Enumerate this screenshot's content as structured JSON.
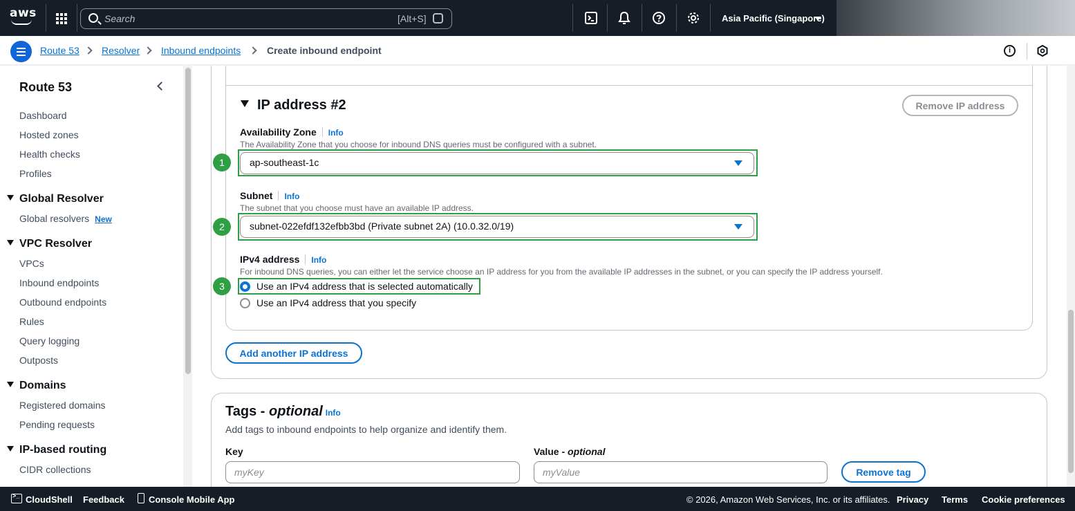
{
  "topnav": {
    "logo_text": "aws",
    "search_placeholder": "Search",
    "search_shortcut": "[Alt+S]",
    "region": "Asia Pacific (Singapore)"
  },
  "breadcrumb": {
    "items": [
      "Route 53",
      "Resolver",
      "Inbound endpoints"
    ],
    "current": "Create inbound endpoint"
  },
  "sidebar": {
    "title": "Route 53",
    "top_items": [
      "Dashboard",
      "Hosted zones",
      "Health checks",
      "Profiles"
    ],
    "sections": [
      {
        "title": "Global Resolver",
        "items": [
          "Global resolvers"
        ],
        "badge": "New"
      },
      {
        "title": "VPC Resolver",
        "items": [
          "VPCs",
          "Inbound endpoints",
          "Outbound endpoints",
          "Rules",
          "Query logging",
          "Outposts"
        ]
      },
      {
        "title": "Domains",
        "items": [
          "Registered domains",
          "Pending requests"
        ]
      },
      {
        "title": "IP-based routing",
        "items": [
          "CIDR collections"
        ]
      }
    ]
  },
  "ip_address": {
    "heading": "IP address #2",
    "remove_button": "Remove IP address",
    "az": {
      "label": "Availability Zone",
      "info": "Info",
      "description": "The Availability Zone that you choose for inbound DNS queries must be configured with a subnet.",
      "value": "ap-southeast-1c",
      "step": "1"
    },
    "subnet": {
      "label": "Subnet",
      "info": "Info",
      "description": "The subnet that you choose must have an available IP address.",
      "value": "subnet-022efdf132efbb3bd (Private subnet 2A) (10.0.32.0/19)",
      "step": "2"
    },
    "ipv4": {
      "label": "IPv4 address",
      "info": "Info",
      "description": "For inbound DNS queries, you can either let the service choose an IP address for you from the available IP addresses in the subnet, or you can specify the IP address yourself.",
      "option_auto": "Use an IPv4 address that is selected automatically",
      "option_manual": "Use an IPv4 address that you specify",
      "selected": "auto",
      "step": "3"
    },
    "add_button": "Add another IP address"
  },
  "tags": {
    "title_main": "Tags -",
    "title_optional": "optional",
    "info": "Info",
    "description": "Add tags to inbound endpoints to help organize and identify them.",
    "key_label": "Key",
    "value_label_main": "Value -",
    "value_label_optional": "optional",
    "key_placeholder": "myKey",
    "value_placeholder": "myValue",
    "remove_button": "Remove tag"
  },
  "footer": {
    "cloudshell": "CloudShell",
    "feedback": "Feedback",
    "mobile_app": "Console Mobile App",
    "copyright": "© 2026, Amazon Web Services, Inc. or its affiliates.",
    "privacy": "Privacy",
    "terms": "Terms",
    "cookies": "Cookie preferences"
  },
  "colors": {
    "nav_bg": "#161d26",
    "link_blue": "#0972d3",
    "highlight_green": "#2ea043"
  }
}
